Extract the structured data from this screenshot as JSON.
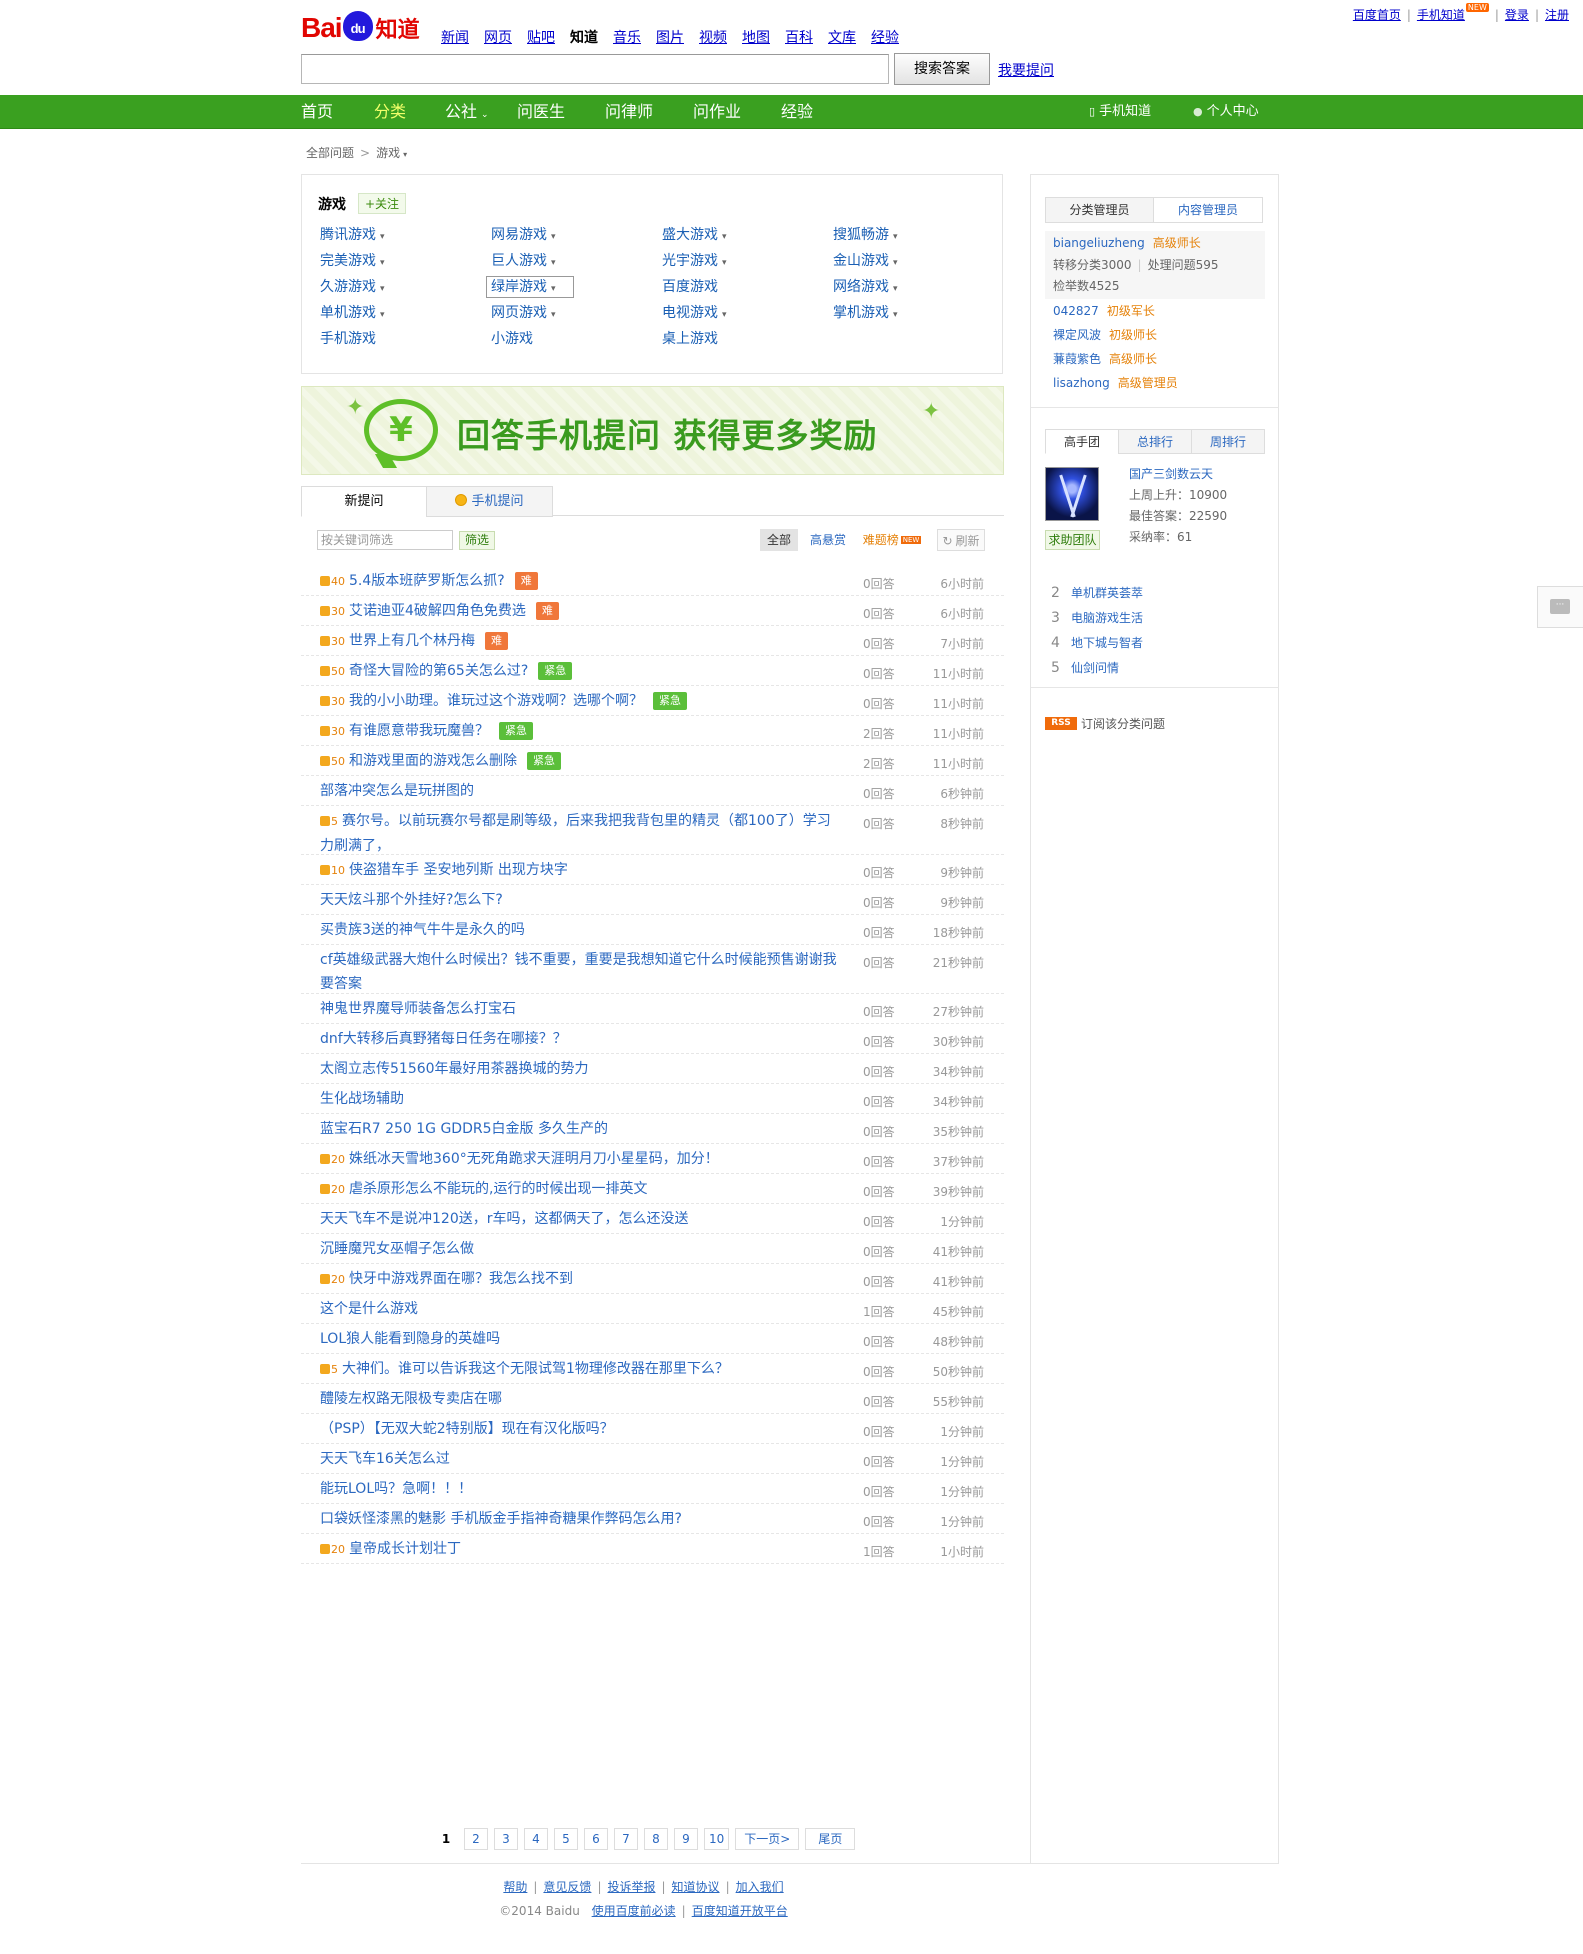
{
  "header": {
    "logo": {
      "left": "Bai",
      "paw": "du",
      "right": "知道"
    },
    "products": [
      "新闻",
      "网页",
      "贴吧",
      "知道",
      "音乐",
      "图片",
      "视频",
      "地图",
      "百科",
      "文库",
      "经验"
    ],
    "current_product": "知道",
    "top_links": {
      "home": "百度首页",
      "mobile": "手机知道",
      "new_badge": "NEW",
      "login": "登录",
      "register": "注册"
    },
    "search": {
      "value": "",
      "button": "搜索答案",
      "ask": "我要提问"
    }
  },
  "nav": {
    "items": [
      "首页",
      "分类",
      "公社",
      "问医生",
      "问律师",
      "问作业",
      "经验"
    ],
    "active": "分类",
    "mobile": "手机知道",
    "personal": "个人中心"
  },
  "breadcrumb": {
    "root": "全部问题",
    "current": "游戏"
  },
  "category": {
    "title": "游戏",
    "follow": "+关注",
    "subcats": [
      {
        "name": "腾讯游戏",
        "dd": true
      },
      {
        "name": "网易游戏",
        "dd": true
      },
      {
        "name": "盛大游戏",
        "dd": true
      },
      {
        "name": "搜狐畅游",
        "dd": true
      },
      {
        "name": "完美游戏",
        "dd": true
      },
      {
        "name": "巨人游戏",
        "dd": true
      },
      {
        "name": "光宇游戏",
        "dd": true
      },
      {
        "name": "金山游戏",
        "dd": true
      },
      {
        "name": "久游游戏",
        "dd": true
      },
      {
        "name": "绿岸游戏",
        "dd": true
      },
      {
        "name": "百度游戏",
        "dd": false
      },
      {
        "name": "网络游戏",
        "dd": true
      },
      {
        "name": "单机游戏",
        "dd": true
      },
      {
        "name": "网页游戏",
        "dd": true
      },
      {
        "name": "电视游戏",
        "dd": true
      },
      {
        "name": "掌机游戏",
        "dd": true
      },
      {
        "name": "手机游戏",
        "dd": false
      },
      {
        "name": "小游戏",
        "dd": false
      },
      {
        "name": "桌上游戏",
        "dd": false
      }
    ]
  },
  "banner": {
    "text": "回答手机提问 获得更多奖励",
    "symbol": "¥"
  },
  "tabs": {
    "new": "新提问",
    "mobile": "手机提问"
  },
  "filter": {
    "placeholder": "按关键词筛选",
    "button": "筛选",
    "all": "全部",
    "high_reward": "高悬赏",
    "hard": "难题榜",
    "hard_new": "NEW",
    "refresh": "刷新"
  },
  "questions": [
    {
      "reward": "40",
      "title": "5.4版本班萨罗斯怎么抓?",
      "tag": "难",
      "tag_type": "hard",
      "answers": "0回答",
      "time": "6小时前"
    },
    {
      "reward": "30",
      "title": "艾诺迪亚4破解四角色免费选",
      "tag": "难",
      "tag_type": "hard",
      "answers": "0回答",
      "time": "6小时前"
    },
    {
      "reward": "30",
      "title": "世界上有几个林丹梅",
      "tag": "难",
      "tag_type": "hard",
      "answers": "0回答",
      "time": "7小时前"
    },
    {
      "reward": "50",
      "title": "奇怪大冒险的第65关怎么过?",
      "tag": "紧急",
      "tag_type": "urgent",
      "answers": "0回答",
      "time": "11小时前"
    },
    {
      "reward": "30",
      "title": "我的小小助理。谁玩过这个游戏啊？选哪个啊？",
      "tag": "紧急",
      "tag_type": "urgent",
      "answers": "0回答",
      "time": "11小时前"
    },
    {
      "reward": "30",
      "title": "有谁愿意带我玩魔兽？",
      "tag": "紧急",
      "tag_type": "urgent",
      "answers": "2回答",
      "time": "11小时前"
    },
    {
      "reward": "50",
      "title": "和游戏里面的游戏怎么删除",
      "tag": "紧急",
      "tag_type": "urgent",
      "answers": "2回答",
      "time": "11小时前"
    },
    {
      "reward": "",
      "title": "部落冲突怎么是玩拼图的",
      "tag": "",
      "tag_type": "",
      "answers": "0回答",
      "time": "6秒钟前"
    },
    {
      "reward": "5",
      "title": "赛尔号。以前玩赛尔号都是刷等级，后来我把我背包里的精灵（都100了）学习力刷满了，",
      "tag": "",
      "tag_type": "",
      "answers": "0回答",
      "time": "8秒钟前"
    },
    {
      "reward": "10",
      "title": "侠盗猎车手 圣安地列斯 出现方块字",
      "tag": "",
      "tag_type": "",
      "answers": "0回答",
      "time": "9秒钟前"
    },
    {
      "reward": "",
      "title": "天天炫斗那个外挂好?怎么下?",
      "tag": "",
      "tag_type": "",
      "answers": "0回答",
      "time": "9秒钟前"
    },
    {
      "reward": "",
      "title": "买贵族3送的神气牛牛是永久的吗",
      "tag": "",
      "tag_type": "",
      "answers": "0回答",
      "time": "18秒钟前"
    },
    {
      "reward": "",
      "title": "cf英雄级武器大炮什么时候出？钱不重要，重要是我想知道它什么时候能预售谢谢我要答案",
      "tag": "",
      "tag_type": "",
      "answers": "0回答",
      "time": "21秒钟前"
    },
    {
      "reward": "",
      "title": "神鬼世界魔导师装备怎么打宝石",
      "tag": "",
      "tag_type": "",
      "answers": "0回答",
      "time": "27秒钟前"
    },
    {
      "reward": "",
      "title": "dnf大转移后真野猪每日任务在哪接？？",
      "tag": "",
      "tag_type": "",
      "answers": "0回答",
      "time": "30秒钟前"
    },
    {
      "reward": "",
      "title": "太阁立志传51560年最好用茶器换城的势力",
      "tag": "",
      "tag_type": "",
      "answers": "0回答",
      "time": "34秒钟前"
    },
    {
      "reward": "",
      "title": "生化战场辅助",
      "tag": "",
      "tag_type": "",
      "answers": "0回答",
      "time": "34秒钟前"
    },
    {
      "reward": "",
      "title": "蓝宝石R7 250 1G GDDR5白金版 多久生产的",
      "tag": "",
      "tag_type": "",
      "answers": "0回答",
      "time": "35秒钟前"
    },
    {
      "reward": "20",
      "title": "姝纸冰天雪地360°无死角跪求天涯明月刀小星星码，加分！",
      "tag": "",
      "tag_type": "",
      "answers": "0回答",
      "time": "37秒钟前"
    },
    {
      "reward": "20",
      "title": "虐杀原形怎么不能玩的,运行的时候出现一排英文",
      "tag": "",
      "tag_type": "",
      "answers": "0回答",
      "time": "39秒钟前"
    },
    {
      "reward": "",
      "title": "天天飞车不是说冲120送，r车吗，这都俩天了，怎么还没送",
      "tag": "",
      "tag_type": "",
      "answers": "0回答",
      "time": "1分钟前"
    },
    {
      "reward": "",
      "title": "沉睡魔咒女巫帽子怎么做",
      "tag": "",
      "tag_type": "",
      "answers": "0回答",
      "time": "41秒钟前"
    },
    {
      "reward": "20",
      "title": "快牙中游戏界面在哪？我怎么找不到",
      "tag": "",
      "tag_type": "",
      "answers": "0回答",
      "time": "41秒钟前"
    },
    {
      "reward": "",
      "title": "这个是什么游戏",
      "tag": "",
      "tag_type": "",
      "answers": "1回答",
      "time": "45秒钟前"
    },
    {
      "reward": "",
      "title": "LOL狼人能看到隐身的英雄吗",
      "tag": "",
      "tag_type": "",
      "answers": "0回答",
      "time": "48秒钟前"
    },
    {
      "reward": "5",
      "title": "大神们。谁可以告诉我这个无限试驾1物理修改器在那里下么？",
      "tag": "",
      "tag_type": "",
      "answers": "0回答",
      "time": "50秒钟前"
    },
    {
      "reward": "",
      "title": "醴陵左权路无限极专卖店在哪",
      "tag": "",
      "tag_type": "",
      "answers": "0回答",
      "time": "55秒钟前"
    },
    {
      "reward": "",
      "title": "（PSP）【无双大蛇2特别版】现在有汉化版吗？",
      "tag": "",
      "tag_type": "",
      "answers": "0回答",
      "time": "1分钟前"
    },
    {
      "reward": "",
      "title": "天天飞车16关怎么过",
      "tag": "",
      "tag_type": "",
      "answers": "0回答",
      "time": "1分钟前"
    },
    {
      "reward": "",
      "title": "能玩LOL吗？急啊！！！",
      "tag": "",
      "tag_type": "",
      "answers": "0回答",
      "time": "1分钟前"
    },
    {
      "reward": "",
      "title": "口袋妖怪漆黑的魅影 手机版金手指神奇糖果作弊码怎么用?",
      "tag": "",
      "tag_type": "",
      "answers": "0回答",
      "time": "1分钟前"
    },
    {
      "reward": "20",
      "title": "皇帝成长计划壮丁",
      "tag": "",
      "tag_type": "",
      "answers": "1回答",
      "time": "1小时前"
    }
  ],
  "pager": {
    "pages": [
      "1",
      "2",
      "3",
      "4",
      "5",
      "6",
      "7",
      "8",
      "9",
      "10"
    ],
    "current": "1",
    "next": "下一页>",
    "last": "尾页"
  },
  "sidebar": {
    "tab_cat": "分类管理员",
    "tab_content": "内容管理员",
    "managers": [
      {
        "name": "biangeliuzheng",
        "level": "高级师长",
        "stat1": "转移分类3000",
        "stat2": "处理问题595",
        "stat3": "检举数4525"
      },
      {
        "name": "042827",
        "level": "初级军长"
      },
      {
        "name": "裸定风波",
        "level": "初级师长"
      },
      {
        "name": "蒹葭紫色",
        "level": "高级师长"
      },
      {
        "name": "lisazhong",
        "level": "高级管理员"
      }
    ],
    "rank_tabs": [
      "高手团",
      "总排行",
      "周排行"
    ],
    "top_user": {
      "name": "国产三剑数云天",
      "rise": "上周上升：10900",
      "best": "最佳答案：22590",
      "rate": "采纳率：61",
      "help": "求助团队"
    },
    "teams": [
      {
        "num": "2",
        "name": "单机群英荟萃"
      },
      {
        "num": "3",
        "name": "电脑游戏生活"
      },
      {
        "num": "4",
        "name": "地下城与智者"
      },
      {
        "num": "5",
        "name": "仙剑问情"
      }
    ],
    "rss_badge": "RSS",
    "rss_text": "订阅该分类问题"
  },
  "footer": {
    "links": [
      "帮助",
      "意见反馈",
      "投诉举报",
      "知道协议",
      "加入我们"
    ],
    "copyright": "©2014 Baidu",
    "must_read": "使用百度前必读",
    "platform": "百度知道开放平台"
  }
}
